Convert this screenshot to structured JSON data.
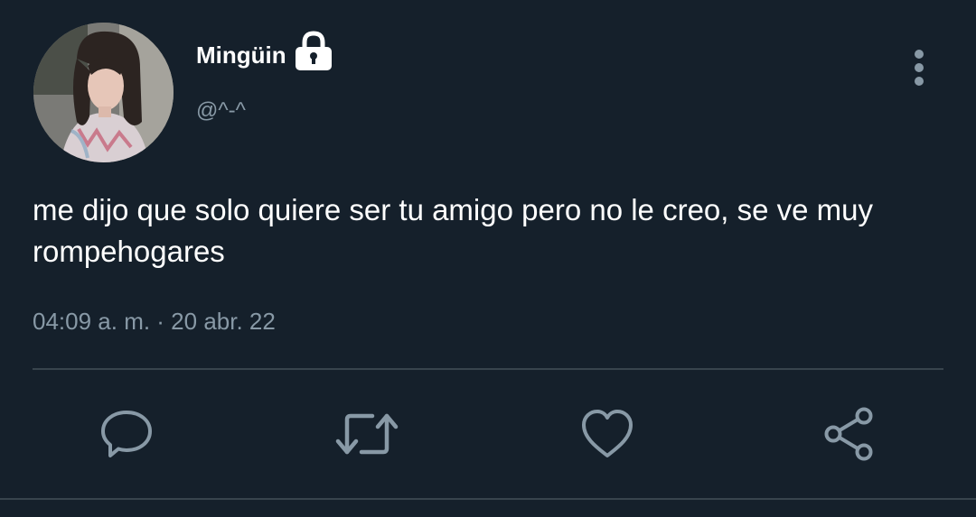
{
  "author": {
    "display_name": "Mingüin",
    "handle": "@^-^",
    "avatar_icon": "profile-photo",
    "protected_icon": "lock-icon"
  },
  "tweet": {
    "text": "me dijo que solo quiere ser tu amigo pero no le creo, se ve muy rompehogares",
    "timestamp": "04:09 a. m. · 20 abr. 22"
  },
  "actions": {
    "reply_icon": "reply-icon",
    "retweet_icon": "retweet-icon",
    "like_icon": "heart-icon",
    "share_icon": "share-icon",
    "more_icon": "more-vertical-icon"
  },
  "colors": {
    "background": "#15202b",
    "text_primary": "#ffffff",
    "text_secondary": "#8899a6",
    "divider": "#38444d"
  }
}
